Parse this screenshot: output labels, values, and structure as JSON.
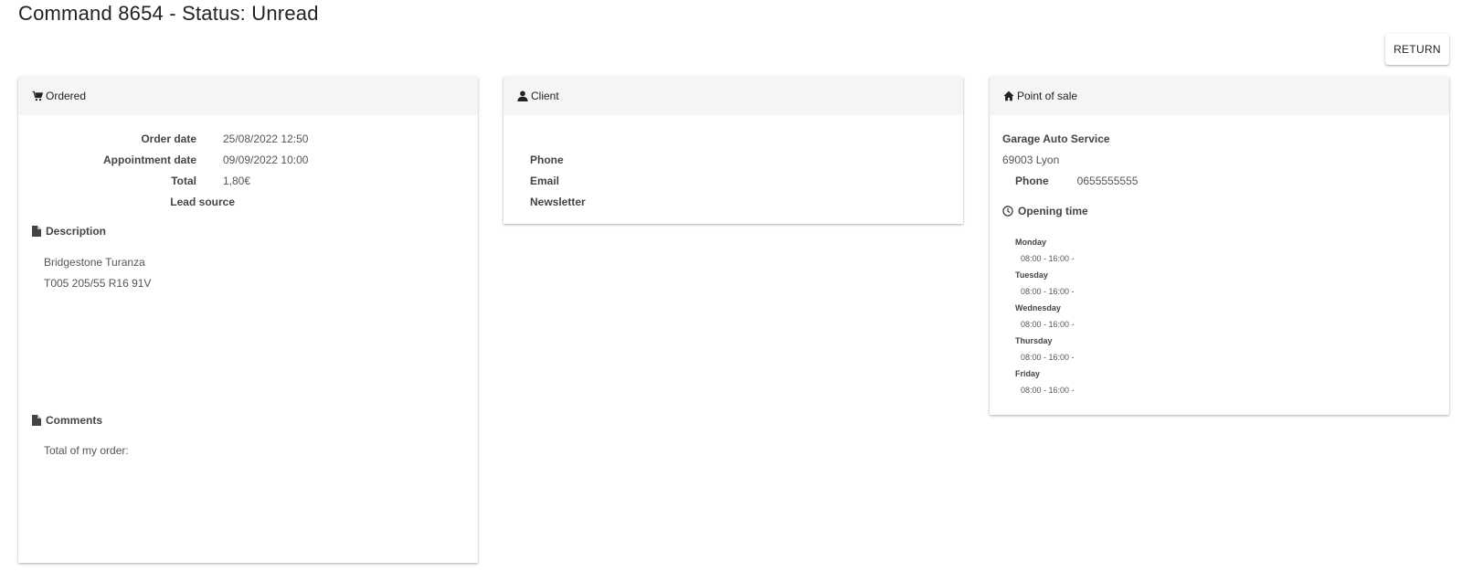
{
  "page": {
    "title": "Command 8654 - Status: Unread",
    "return_label": "RETURN"
  },
  "ordered": {
    "header": "Ordered",
    "fields": [
      {
        "label": "Order date",
        "value": "25/08/2022 12:50"
      },
      {
        "label": "Appointment date",
        "value": "09/09/2022 10:00"
      },
      {
        "label": "Total",
        "value": "1,80€"
      },
      {
        "label": "Lead source",
        "value": ""
      }
    ],
    "description_title": "Description",
    "description_lines": [
      "Bridgestone Turanza",
      "T005 205/55 R16 91V"
    ],
    "comments_title": "Comments",
    "comments_text": "Total of my order:"
  },
  "client": {
    "header": "Client",
    "fields": [
      {
        "label": "Phone",
        "value": ""
      },
      {
        "label": "Email",
        "value": ""
      },
      {
        "label": "Newsletter",
        "value": ""
      }
    ]
  },
  "point_of_sale": {
    "header": "Point of sale",
    "name": "Garage Auto Service",
    "city": "69003 Lyon",
    "phone_label": "Phone",
    "phone_value": "0655555555",
    "opening_title": "Opening time",
    "opening_hours": [
      {
        "day": "Monday",
        "hours": "08:00 - 16:00 -"
      },
      {
        "day": "Tuesday",
        "hours": "08:00 - 16:00 -"
      },
      {
        "day": "Wednesday",
        "hours": "08:00 - 16:00 -"
      },
      {
        "day": "Thursday",
        "hours": "08:00 - 16:00 -"
      },
      {
        "day": "Friday",
        "hours": "08:00 - 16:00 -"
      }
    ]
  },
  "icons": {
    "ordered": "cart-icon",
    "client": "user-icon",
    "point_of_sale": "home-icon",
    "description": "file-icon",
    "comments": "file-icon",
    "opening": "clock-icon"
  }
}
